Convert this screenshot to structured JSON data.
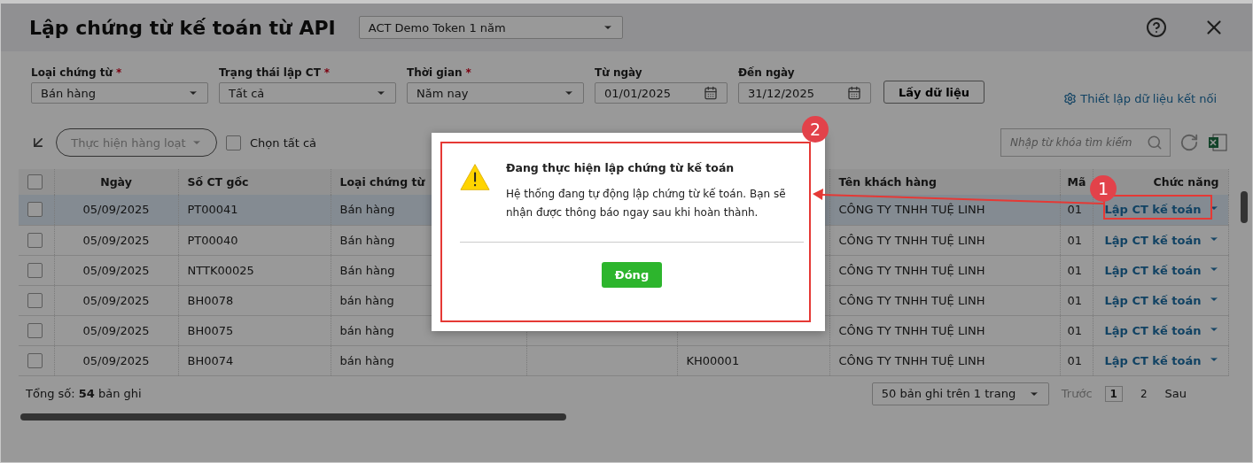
{
  "window": {
    "title": "Lập chứng từ kế toán từ API",
    "token_select": "ACT Demo Token 1 năm"
  },
  "filters": [
    {
      "kind": "select",
      "label": "Loại chứng từ",
      "required_mark": "*",
      "value": "Bán hàng"
    },
    {
      "kind": "select",
      "label": "Trạng thái lập CT",
      "required_mark": "*",
      "value": "Tất cả"
    },
    {
      "kind": "select",
      "label": "Thời gian",
      "required_mark": "*",
      "value": "Năm nay"
    },
    {
      "kind": "date",
      "label": "Từ ngày",
      "value": "01/01/2025"
    },
    {
      "kind": "date",
      "label": "Đến ngày",
      "value": "31/12/2025"
    }
  ],
  "fetch_button": "Lấy dữ liệu",
  "settings_link": "Thiết lập dữ liệu kết nối",
  "toolbar": {
    "bulk_action": "Thực hiện hàng loạt",
    "bulk_disabled": true,
    "select_all": {
      "label": "Chọn tất cả",
      "checked": false
    },
    "search": {
      "placeholder": "Nhập từ khóa tìm kiếm"
    }
  },
  "table": {
    "all_checked": false,
    "columns": [
      "Ngày",
      "Số CT gốc",
      "Loại chứng từ",
      "Tên khách hàng",
      "Mã",
      "Chức năng"
    ],
    "rows": [
      {
        "selected": true,
        "checked": false,
        "date": "05/09/2025",
        "doc_no": "PT00041",
        "doc_type": "Bán hàng",
        "customer": "CÔNG TY TNHH TUỆ LINH",
        "code": "01",
        "action": "Lập CT kế toán"
      },
      {
        "selected": false,
        "checked": false,
        "date": "05/09/2025",
        "doc_no": "PT00040",
        "doc_type": "Bán hàng",
        "customer": "CÔNG TY TNHH TUỆ LINH",
        "code": "01",
        "action": "Lập CT kế toán"
      },
      {
        "selected": false,
        "checked": false,
        "date": "05/09/2025",
        "doc_no": "NTTK00025",
        "doc_type": "Bán hàng",
        "customer": "CÔNG TY TNHH TUỆ LINH",
        "code": "01",
        "action": "Lập CT kế toán"
      },
      {
        "selected": false,
        "checked": false,
        "date": "05/09/2025",
        "doc_no": "BH0078",
        "doc_type": "bán hàng",
        "customer": "CÔNG TY TNHH TUỆ LINH",
        "code": "01",
        "action": "Lập CT kế toán"
      },
      {
        "selected": false,
        "checked": false,
        "date": "05/09/2025",
        "doc_no": "BH0075",
        "doc_type": "bán hàng",
        "customer": "CÔNG TY TNHH TUỆ LINH",
        "code": "01",
        "action": "Lập CT kế toán"
      },
      {
        "selected": false,
        "checked": false,
        "date": "05/09/2025",
        "doc_no": "BH0074",
        "doc_type": "bán hàng",
        "column_5": "KH00001",
        "customer": "CÔNG TY TNHH TUỆ LINH",
        "code": "01",
        "action": "Lập CT kế toán"
      }
    ]
  },
  "footer": {
    "total": "Tổng số: **54** bản ghi",
    "page_size": "50 bản ghi trên 1 trang",
    "prev": "Trước",
    "pages": [
      {
        "label": "1",
        "selected": true
      },
      {
        "label": "2",
        "selected": false
      }
    ],
    "next": "Sau"
  },
  "dialog": {
    "title": "Đang thực hiện lập chứng từ kế toán",
    "message": "Hệ thống đang tự động lập chứng từ kế toán. Bạn sẽ nhận được thông báo ngay sau khi hoàn thành.",
    "button": "Đóng"
  },
  "annotations": [
    {
      "label": "1"
    },
    {
      "label": "2"
    }
  ]
}
